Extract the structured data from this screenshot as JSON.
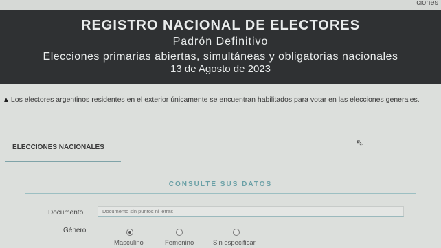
{
  "top_strip": {
    "partial_text": "ciones"
  },
  "header": {
    "title": "REGISTRO NACIONAL DE ELECTORES",
    "subtitle": "Padrón Definitivo",
    "election": "Elecciones primarias abiertas, simultáneas y obligatorias nacionales",
    "date": "13 de Agosto de 2023"
  },
  "notice": {
    "icon": "warning-icon",
    "text": "Los electores argentinos residentes en el exterior únicamente se encuentran habilitados para votar en las elecciones generales."
  },
  "tabs": [
    {
      "label": "ELECCIONES NACIONALES",
      "active": true
    }
  ],
  "form": {
    "section_title": "CONSULTE SUS DATOS",
    "document": {
      "label": "Documento",
      "placeholder": "Documento sin puntos ni letras",
      "value": ""
    },
    "gender": {
      "label": "Género",
      "options": [
        {
          "label": "Masculino",
          "selected": true
        },
        {
          "label": "Femenino",
          "selected": false
        },
        {
          "label": "Sin especificar",
          "selected": false
        }
      ]
    }
  }
}
